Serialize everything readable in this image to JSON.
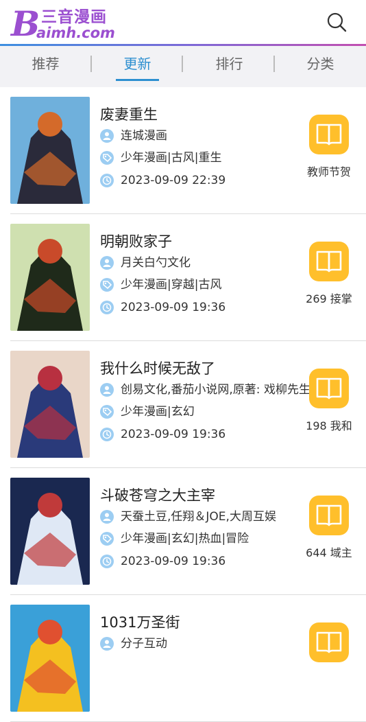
{
  "header": {
    "logo_cn": "三音漫画",
    "logo_b": "B",
    "logo_en": "aimh.com"
  },
  "tabs": [
    {
      "label": "推荐",
      "active": false
    },
    {
      "label": "更新",
      "active": true
    },
    {
      "label": "排行",
      "active": false
    },
    {
      "label": "分类",
      "active": false
    }
  ],
  "colors": {
    "accent": "#2d8fd0",
    "brand": "#9b4fd0",
    "read_button": "#ffbf2b",
    "meta_icon": "#9ccdf2"
  },
  "items": [
    {
      "title": "废妻重生",
      "author": "连城漫画",
      "tags": "少年漫画|古风|重生",
      "time": "2023-09-09 22:39",
      "chapter": "教师节贺",
      "cover_colors": [
        "#6fb0dc",
        "#2a2a3a",
        "#d46a2a"
      ]
    },
    {
      "title": "明朝败家子",
      "author": "月关白勺文化",
      "tags": "少年漫画|穿越|古风",
      "time": "2023-09-09 19:36",
      "chapter": "269 接掌",
      "cover_colors": [
        "#cfe0b0",
        "#1f2a1a",
        "#c94a2a"
      ]
    },
    {
      "title": "我什么时候无敌了",
      "author": "创易文化,番茄小说网,原著: 戏柳先生",
      "tags": "少年漫画|玄幻",
      "time": "2023-09-09 19:36",
      "chapter": "198 我和",
      "cover_colors": [
        "#e9d6c8",
        "#2a3a7a",
        "#b83040"
      ]
    },
    {
      "title": "斗破苍穹之大主宰",
      "author": "天蚕土豆,任翔＆JOE,大周互娱",
      "tags": "少年漫画|玄幻|热血|冒险",
      "time": "2023-09-09 19:36",
      "chapter": "644 域主",
      "cover_colors": [
        "#1a2850",
        "#dfe8f5",
        "#c03a3a"
      ]
    },
    {
      "title": "1031万圣街",
      "author": "分子互动",
      "tags": "",
      "time": "",
      "chapter": "",
      "cover_colors": [
        "#3aa0d8",
        "#f4c020",
        "#e05030"
      ]
    }
  ]
}
